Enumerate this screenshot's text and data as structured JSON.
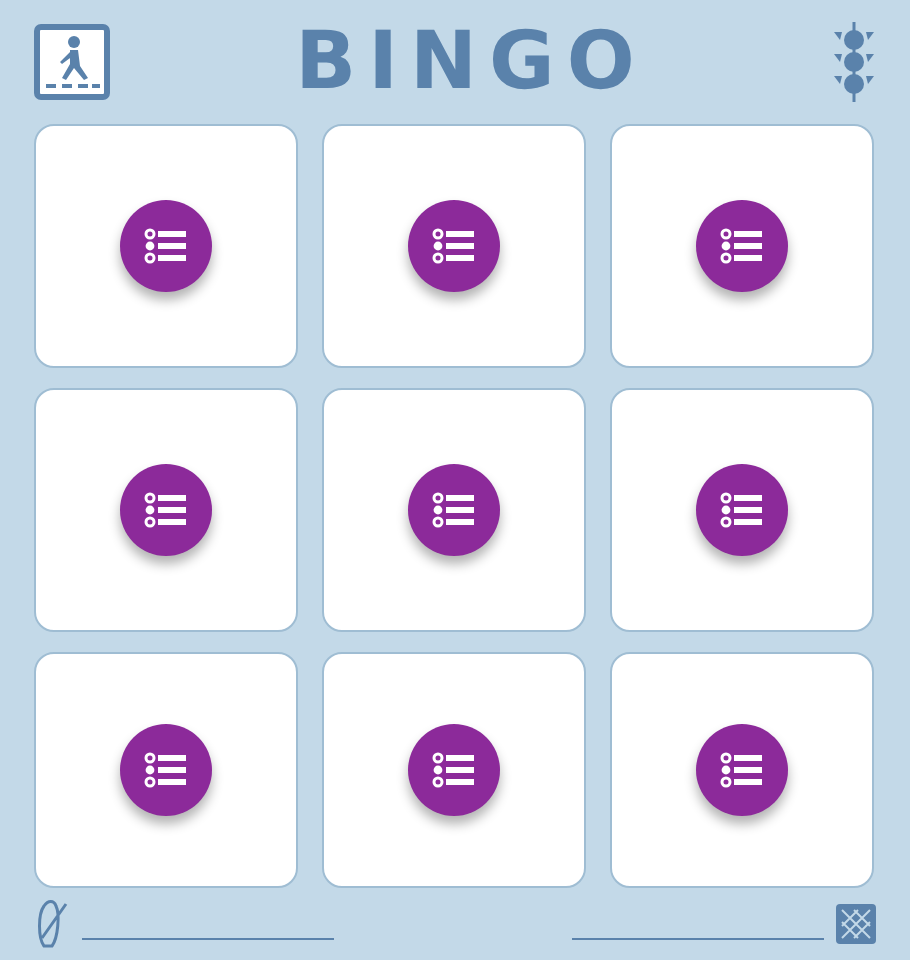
{
  "title": "BINGO",
  "cards": [
    {
      "kind": "list"
    },
    {
      "kind": "list"
    },
    {
      "kind": "list"
    },
    {
      "kind": "list"
    },
    {
      "kind": "list"
    },
    {
      "kind": "list"
    },
    {
      "kind": "list"
    },
    {
      "kind": "list"
    },
    {
      "kind": "list"
    }
  ]
}
